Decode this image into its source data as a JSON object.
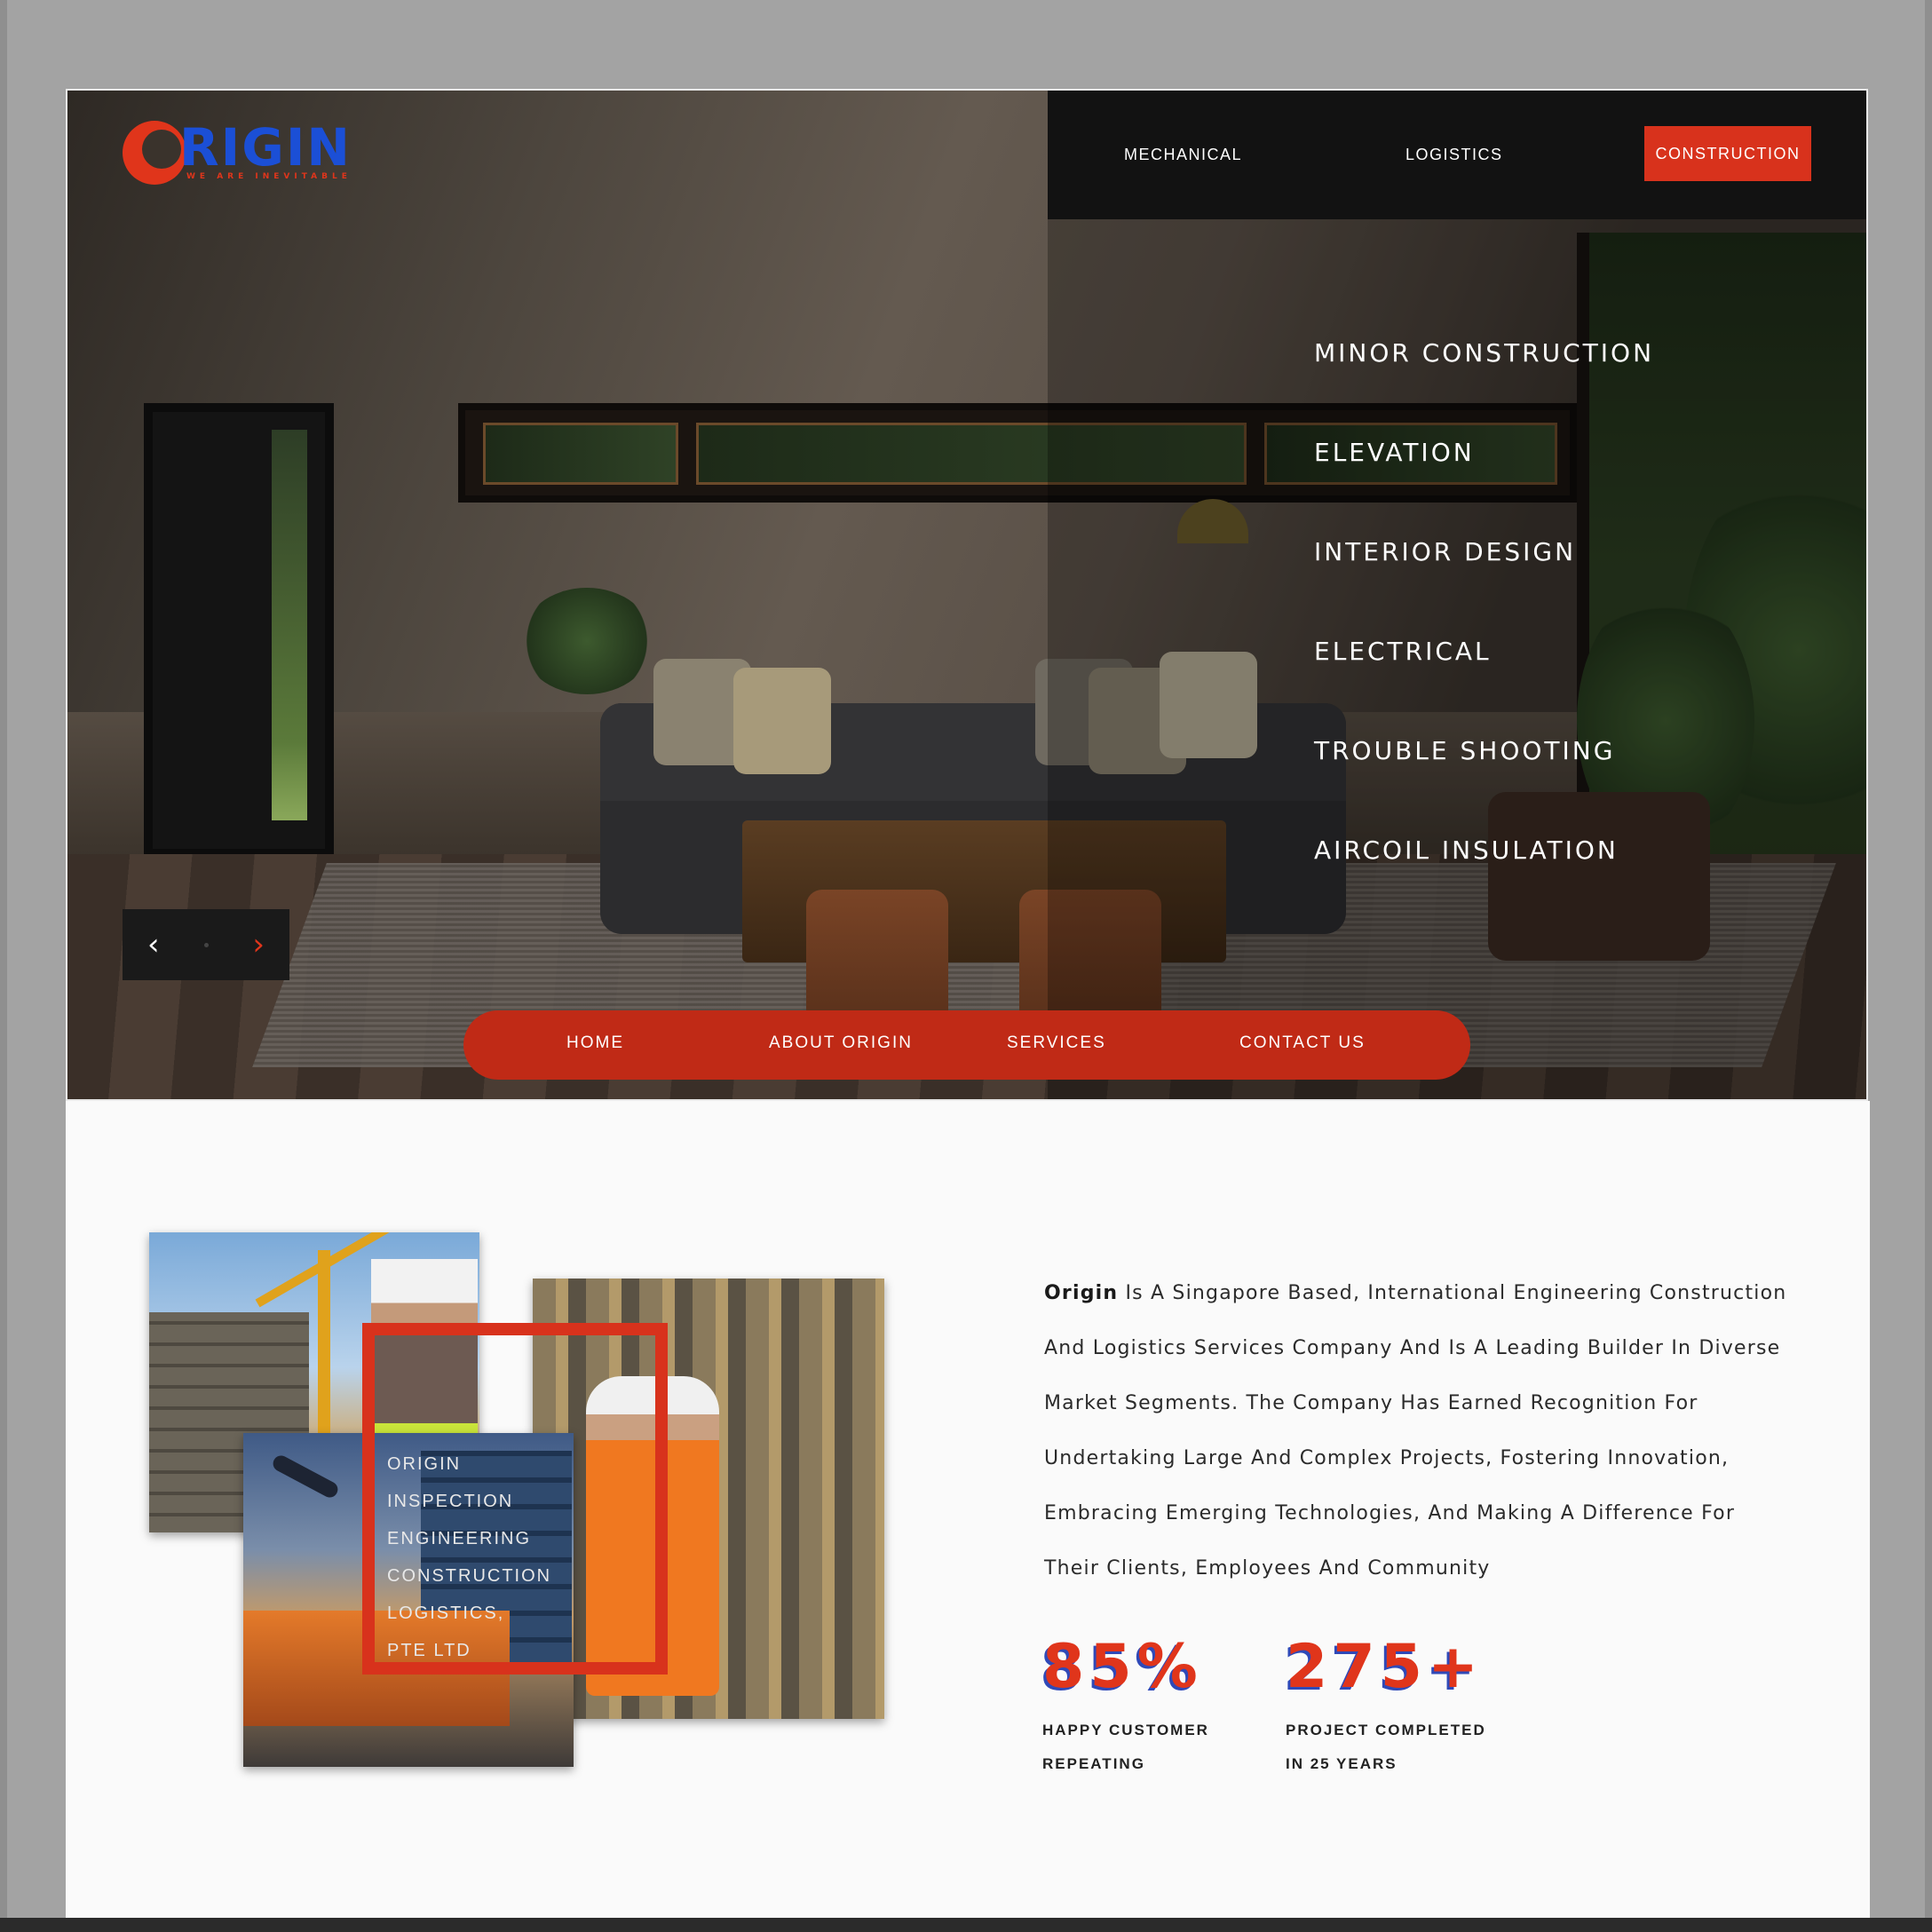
{
  "brand": {
    "logo_word": "RIGIN",
    "logo_tagline": "WE ARE INEVITABLE",
    "accent_color": "#d8321c",
    "logo_blue": "#1b4fd6"
  },
  "topnav": {
    "mechanical": "MECHANICAL",
    "logistics": "LOGISTICS",
    "construction": "CONSTRUCTION"
  },
  "services": [
    "MINOR CONSTRUCTION",
    "ELEVATION",
    "INTERIOR DESIGN",
    "ELECTRICAL",
    "TROUBLE SHOOTING",
    "AIRCOIL INSULATION"
  ],
  "slider": {
    "prev_icon": "chevron-left-icon",
    "next_icon": "chevron-right-icon"
  },
  "mainnav": {
    "home": "HOME",
    "about": "ABOUT ORIGIN",
    "services": "SERVICES",
    "contact": "CONTACT US"
  },
  "collage_caption": [
    "ORIGIN",
    "INSPECTION",
    "ENGINEERING",
    "CONSTRUCTION",
    "LOGISTICS,",
    "PTE LTD"
  ],
  "about": {
    "brand_word": "Origin",
    "lines": [
      " Is A Singapore Based, International Engineering Construction",
      "And Logistics Services Company And Is A Leading Builder In Diverse",
      "Market Segments. The Company Has Earned Recognition For",
      "Undertaking Large And Complex Projects, Fostering Innovation,",
      "Embracing Emerging Technologies, And Making A Difference For",
      "Their Clients, Employees And Community"
    ]
  },
  "stats": [
    {
      "value": "85%",
      "label_line1": "HAPPY CUSTOMER",
      "label_line2": "REPEATING"
    },
    {
      "value": "275+",
      "label_line1": "PROJECT COMPLETED",
      "label_line2": "IN 25 YEARS"
    }
  ]
}
